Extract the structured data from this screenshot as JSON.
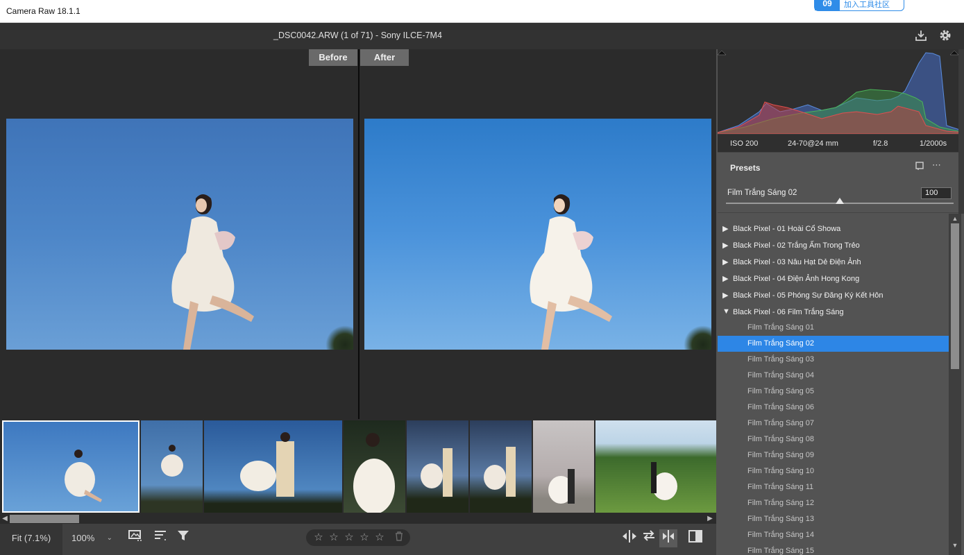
{
  "window": {
    "title": "Camera Raw 18.1.1",
    "badge_num": "09",
    "badge_text": "加入工具社区"
  },
  "header": {
    "filename": "_DSC0042.ARW (1 of 71)  -  Sony ILCE-7M4"
  },
  "viewer": {
    "before_label": "Before",
    "after_label": "After"
  },
  "exif": {
    "iso": "ISO 200",
    "lens": "24-70@24 mm",
    "aperture": "f/2.8",
    "shutter": "1/2000s"
  },
  "presets": {
    "label": "Presets",
    "amount_label": "Film Trắng Sáng 02",
    "amount_value": "100",
    "amount_fraction": 0.5,
    "groups": [
      "Black Pixel - 01 Hoài Cổ Showa",
      "Black Pixel - 02 Trắng Ấm Trong Trẻo",
      "Black Pixel - 03 Nâu Hạt Dẻ Điện Ảnh",
      "Black Pixel - 04 Điện Ảnh Hong Kong",
      "Black Pixel - 05 Phóng Sự Đăng Ký Kết Hôn",
      "Black Pixel - 06 Film Trắng Sáng"
    ],
    "items": [
      "Film Trắng Sáng 01",
      "Film Trắng Sáng 02",
      "Film Trắng Sáng 03",
      "Film Trắng Sáng 04",
      "Film Trắng Sáng 05",
      "Film Trắng Sáng 06",
      "Film Trắng Sáng 07",
      "Film Trắng Sáng 08",
      "Film Trắng Sáng 09",
      "Film Trắng Sáng 10",
      "Film Trắng Sáng 11",
      "Film Trắng Sáng 12",
      "Film Trắng Sáng 13",
      "Film Trắng Sáng 14",
      "Film Trắng Sáng 15"
    ],
    "selected_item": "Film Trắng Sáng 02"
  },
  "bottom": {
    "fit_label": "Fit (7.1%)",
    "zoom_label": "100%"
  },
  "colors": {
    "accent": "#2d86e6",
    "panel": "#535353",
    "dark": "#2b2b2b"
  }
}
